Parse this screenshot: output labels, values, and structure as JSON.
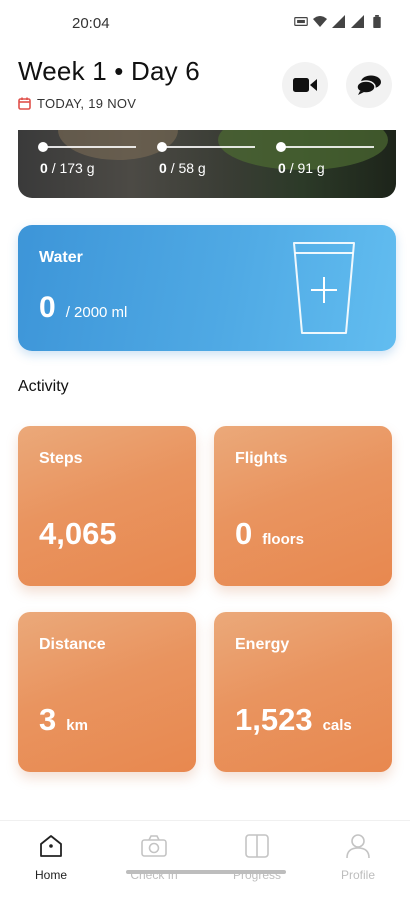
{
  "status": {
    "time": "20:04"
  },
  "header": {
    "title": "Week 1 • Day 6",
    "date": "TODAY, 19 NOV",
    "video_icon": "video-camera-icon",
    "chat_icon": "chat-bubbles-icon",
    "calendar_icon": "calendar-icon"
  },
  "meal": {
    "macros": [
      {
        "current": "0",
        "target": "/ 173 g"
      },
      {
        "current": "0",
        "target": "/ 58 g"
      },
      {
        "current": "0",
        "target": "/ 91 g"
      }
    ]
  },
  "water": {
    "title": "Water",
    "value": "0",
    "target": "/ 2000 ml",
    "add_icon": "add-water-cup-icon"
  },
  "activity": {
    "title": "Activity",
    "steps": {
      "label": "Steps",
      "value": "4,065",
      "unit": ""
    },
    "flights": {
      "label": "Flights",
      "value": "0",
      "unit": "floors"
    },
    "distance": {
      "label": "Distance",
      "value": "3",
      "unit": "km"
    },
    "energy": {
      "label": "Energy",
      "value": "1,523",
      "unit": "cals"
    }
  },
  "nav": {
    "home": "Home",
    "checkin": "Check In",
    "progress": "Progress",
    "profile": "Profile",
    "active": "home"
  },
  "colors": {
    "water_card": "#4fa9e4",
    "activity_card": "#e9945f",
    "nav_inactive": "#bdbdbd"
  }
}
